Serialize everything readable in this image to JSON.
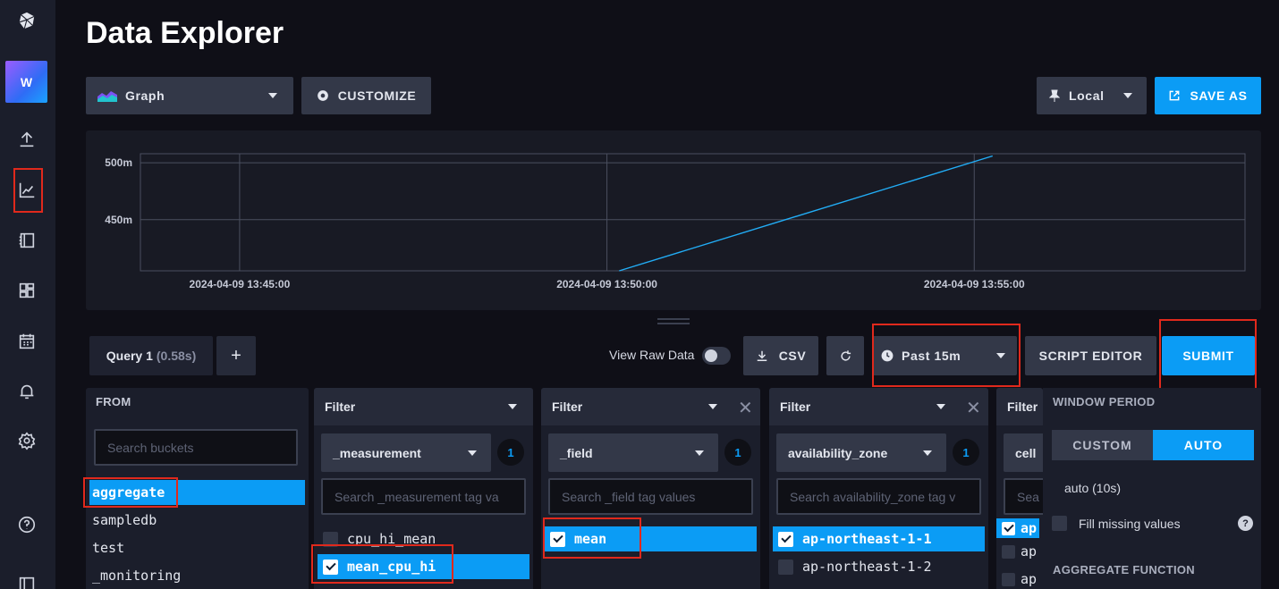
{
  "app": {
    "title": "Data Explorer",
    "org_initial": "W"
  },
  "sidebar": {
    "icons": [
      "logo-icon",
      "upload-icon",
      "graph-icon",
      "notebook-icon",
      "dashboards-icon",
      "tasks-icon",
      "alerts-icon",
      "settings-icon",
      "help-icon",
      "collapse-icon"
    ]
  },
  "toolbar": {
    "view_type": "Graph",
    "customize_label": "CUSTOMIZE",
    "timezone": "Local",
    "save_as_label": "SAVE AS"
  },
  "chart_data": {
    "type": "line",
    "x_ticks": [
      "2024-04-09 13:45:00",
      "2024-04-09 13:50:00",
      "2024-04-09 13:55:00"
    ],
    "y_ticks": [
      "500m",
      "450m"
    ],
    "ylim": [
      405,
      508
    ],
    "grid": true,
    "series": [
      {
        "color": "#22adf6",
        "x": [
          "2024-04-09 13:50:10",
          "2024-04-09 13:55:15"
        ],
        "y": [
          405,
          506
        ]
      }
    ]
  },
  "query_bar": {
    "query_name": "Query 1",
    "query_time": "(0.58s)",
    "add_label": "+",
    "view_raw_label": "View Raw Data",
    "csv_label": "CSV",
    "time_range": "Past 15m",
    "script_editor_label": "SCRIPT EDITOR",
    "submit_label": "SUBMIT"
  },
  "from_panel": {
    "title": "FROM",
    "search_placeholder": "Search buckets",
    "buckets": [
      {
        "name": "aggregate",
        "selected": true
      },
      {
        "name": "sampledb",
        "selected": false
      },
      {
        "name": "test",
        "selected": false
      },
      {
        "name": "_monitoring",
        "selected": false
      }
    ]
  },
  "filters": [
    {
      "head": "Filter",
      "key": "_measurement",
      "count": "1",
      "search_placeholder": "Search _measurement tag va",
      "values": [
        {
          "name": "cpu_hi_mean",
          "checked": false
        },
        {
          "name": "mean_cpu_hi",
          "checked": true
        }
      ]
    },
    {
      "head": "Filter",
      "key": "_field",
      "count": "1",
      "search_placeholder": "Search _field tag values",
      "values": [
        {
          "name": "mean",
          "checked": true
        }
      ]
    },
    {
      "head": "Filter",
      "key": "availability_zone",
      "count": "1",
      "search_placeholder": "Search availability_zone tag v",
      "values": [
        {
          "name": "ap-northeast-1-1",
          "checked": true
        },
        {
          "name": "ap-northeast-1-2",
          "checked": false
        }
      ]
    },
    {
      "head": "Filter",
      "key": "cell",
      "search_placeholder": "Sea",
      "values": [
        {
          "name": "ap",
          "checked": true
        },
        {
          "name": "ap",
          "checked": false
        },
        {
          "name": "ap",
          "checked": false
        }
      ]
    }
  ],
  "window_period": {
    "title": "WINDOW PERIOD",
    "custom_label": "CUSTOM",
    "auto_label": "AUTO",
    "auto_value": "auto (10s)",
    "fill_missing_label": "Fill missing values",
    "help": "?",
    "aggregate_title": "AGGREGATE FUNCTION"
  }
}
